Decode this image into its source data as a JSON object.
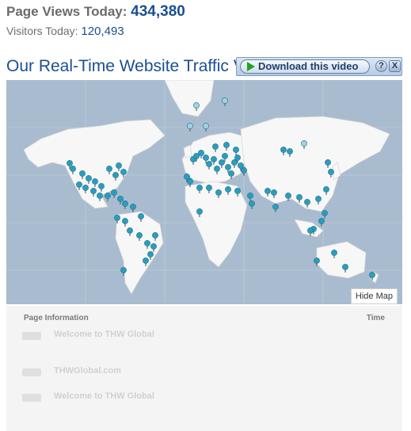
{
  "stats": {
    "page_views_label": "Page Views Today:",
    "page_views_value": "434,380",
    "visitors_label": "Visitors Today:",
    "visitors_value": "120,493"
  },
  "section": {
    "title": "Our Real-Time Website Traffic V"
  },
  "video_bar": {
    "download_label": "Download this video",
    "help_label": "?",
    "close_label": "X"
  },
  "map": {
    "hide_label": "Hide Map",
    "pin_color": "#2a9dbf",
    "faded_pin_color": "#9fd2e3",
    "land_color": "#f7f7f7",
    "water_color": "#a9bccf"
  },
  "table": {
    "col_page": "Page Information",
    "col_time": "Time",
    "rows": [
      {
        "title": "Welcome to THW Global",
        "desc": ""
      },
      {
        "title": "THWGlobal.com",
        "desc": ""
      },
      {
        "title": "Welcome to THW Global",
        "desc": ""
      }
    ]
  }
}
